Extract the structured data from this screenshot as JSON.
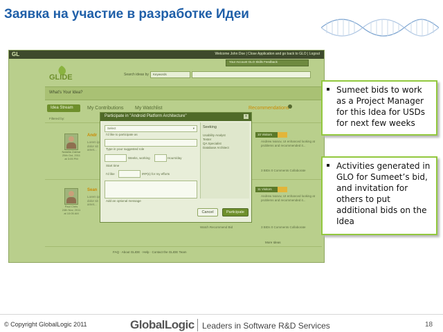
{
  "slide": {
    "title": "Заявка на участие в разработке Идеи",
    "page_number": "18"
  },
  "app": {
    "topbar": {
      "logo": "GL",
      "links": "Welcome John Doe  |  Close Application and go back to GLO  |  Logout"
    },
    "userbar": "Your Account  GLO Skills  Feedback",
    "logo_text": "GLIDE",
    "search": {
      "label": "Search ideas by",
      "select_value": "Keywords",
      "placeholder": ""
    },
    "banner": "What's Your Idea?",
    "tabs": [
      {
        "label": "Idea Stream"
      },
      {
        "label": "My Contributions"
      },
      {
        "label": "My Watchlist"
      }
    ],
    "recommendations_label": "Recommendations",
    "filter_row": "Filtered by:",
    "entries": [
      {
        "author": "Nataliia Zakhar",
        "date": "25th Oct, 2011",
        "time": "at 3:05 PM",
        "title": "Andr",
        "text": "Lorem ipsum dolor sit amet...",
        "badge": "10 Visitors",
        "side_text": "Andrew Ivanov, UI enhanced looking at problems and recommended it...",
        "counts": "3 BIDs  0 Comments  Collaborate"
      },
      {
        "author": "Paul Chris",
        "date": "24th Nov, 2011",
        "time": "at 10:05 AM",
        "title": "Sean",
        "text": "Lorem ipsum dolor sit amet...",
        "badge": "11 Visitors",
        "side_text": "Andrew Ivanov, UI enhanced looking at problems and recommended it...",
        "counts": "3 BIDs  0 Comments  Collaborate"
      }
    ],
    "entry_actions": "Watch   Recommend   Bid",
    "more_ideas": "More Ideas",
    "footer_links": "FAQ  ·  About GLIDE  ·  Help  ·  Contact the GLIDE Team",
    "modal": {
      "title": "Participate in \"Android Platform Architecture\"",
      "close": "x",
      "select_value": "Select",
      "role_label": "I'd like to participate as",
      "role_placeholder": "Type in your suggested role",
      "weeks_label": "Weeks, working",
      "hours_label": "Hours/day",
      "start_label": "Start time",
      "fee_prefix": "I'd like",
      "fee_suffix": "IRP(s) for my efforts",
      "message_label": "Add an optional message",
      "seeking_title": "Seeking",
      "seeking_items": [
        "Usability Analyst",
        "Tester",
        "QA Specialist",
        "Database Architect"
      ],
      "cancel_label": "Cancel",
      "participate_label": "Participate"
    }
  },
  "callouts": [
    {
      "text": "Sumeet bids to work as a Project Manager for this Idea for USDs for next few weeks"
    },
    {
      "text": "Activities generated in GLO for Sumeet’s bid, and invitation for others to put additional bids on the Idea"
    }
  ],
  "footer": {
    "copyright": "© Copyright GlobalLogic 2011",
    "brand_part1": "Global",
    "brand_part2": "Logic",
    "tagline": "Leaders in Software R&D Services"
  },
  "colors": {
    "title_blue": "#1f5fa8",
    "callout_border": "#92c83e",
    "app_green": "#b9cf8c",
    "accent_orange": "#cc8a00"
  }
}
